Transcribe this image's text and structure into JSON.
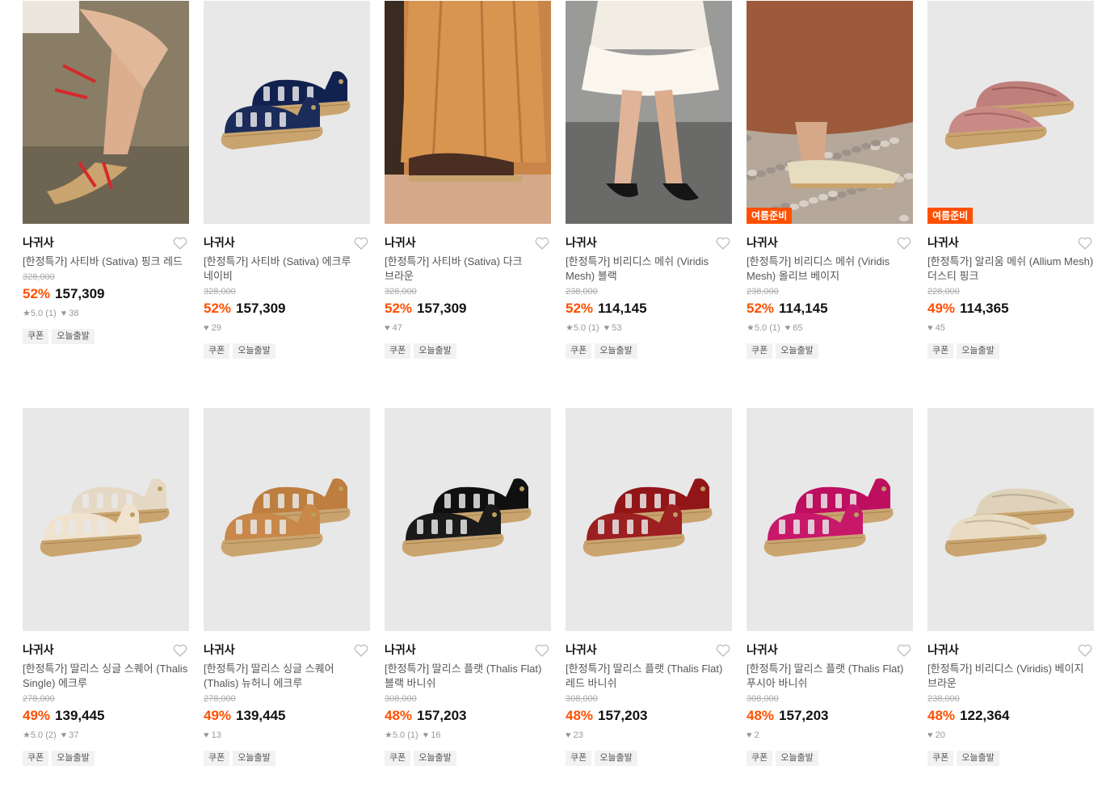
{
  "products": [
    {
      "brand": "나귀사",
      "name": "[한정특가] 사티바 (Sativa) 핑크 레드",
      "original_price": "328,000",
      "discount": "52%",
      "price": "157,309",
      "rating": "5.0 (1)",
      "likes": "38",
      "badge": "",
      "tags": [
        "쿠폰",
        "오늘출발"
      ],
      "image": {
        "bg": "#8a7d66",
        "kind": "photo-legs",
        "accent": "#d42a2a"
      }
    },
    {
      "brand": "나귀사",
      "name": "[한정특가] 사티바 (Sativa) 에크루 네이비",
      "original_price": "328,000",
      "discount": "52%",
      "price": "157,309",
      "rating": "",
      "likes": "29",
      "badge": "",
      "tags": [
        "쿠폰",
        "오늘출발"
      ],
      "image": {
        "bg": "#e8e8e8",
        "kind": "product",
        "accent": "#1c2c5a"
      }
    },
    {
      "brand": "나귀사",
      "name": "[한정특가] 사티바 (Sativa) 다크 브라운",
      "original_price": "328,000",
      "discount": "52%",
      "price": "157,309",
      "rating": "",
      "likes": "47",
      "badge": "",
      "tags": [
        "쿠폰",
        "오늘출발"
      ],
      "image": {
        "bg": "#c9844a",
        "kind": "photo-dress",
        "accent": "#4a2e22"
      }
    },
    {
      "brand": "나귀사",
      "name": "[한정특가] 비리디스 메쉬 (Viridis Mesh) 블랙",
      "original_price": "238,000",
      "discount": "52%",
      "price": "114,145",
      "rating": "5.0 (1)",
      "likes": "53",
      "badge": "",
      "tags": [
        "쿠폰",
        "오늘출발"
      ],
      "image": {
        "bg": "#9a9a98",
        "kind": "photo-skirt",
        "accent": "#151515"
      }
    },
    {
      "brand": "나귀사",
      "name": "[한정특가] 비리디스 메쉬 (Viridis Mesh) 올리브 베이지",
      "original_price": "238,000",
      "discount": "52%",
      "price": "114,145",
      "rating": "5.0 (1)",
      "likes": "65",
      "badge": "여름준비",
      "tags": [
        "쿠폰",
        "오늘출발"
      ],
      "image": {
        "bg": "#b5a89a",
        "kind": "photo-gravel",
        "accent": "#e6dcc0"
      }
    },
    {
      "brand": "나귀사",
      "name": "[한정특가] 알리움 메쉬 (Allium Mesh) 더스티 핑크",
      "original_price": "228,000",
      "discount": "49%",
      "price": "114,365",
      "rating": "",
      "likes": "45",
      "badge": "여름준비",
      "tags": [
        "쿠폰",
        "오늘출발"
      ],
      "image": {
        "bg": "#e8e8e8",
        "kind": "product-flat",
        "accent": "#c98a86"
      }
    },
    {
      "brand": "나귀사",
      "name": "[한정특가] 딸리스 싱글 스퀘어 (Thalis Single) 에크루",
      "original_price": "278,000",
      "discount": "49%",
      "price": "139,445",
      "rating": "5.0 (2)",
      "likes": "37",
      "badge": "",
      "tags": [
        "쿠폰",
        "오늘출발"
      ],
      "image": {
        "bg": "#e8e8e8",
        "kind": "product",
        "accent": "#efe3cf"
      }
    },
    {
      "brand": "나귀사",
      "name": "[한정특가] 딸리스 싱글 스퀘어 (Thalis) 뉴허니 에크루",
      "original_price": "278,000",
      "discount": "49%",
      "price": "139,445",
      "rating": "",
      "likes": "13",
      "badge": "",
      "tags": [
        "쿠폰",
        "오늘출발"
      ],
      "image": {
        "bg": "#e8e8e8",
        "kind": "product",
        "accent": "#c7884a"
      }
    },
    {
      "brand": "나귀사",
      "name": "[한정특가] 딸리스 플랫 (Thalis Flat) 블랙 바니쉬",
      "original_price": "308,000",
      "discount": "48%",
      "price": "157,203",
      "rating": "5.0 (1)",
      "likes": "16",
      "badge": "",
      "tags": [
        "쿠폰",
        "오늘출발"
      ],
      "image": {
        "bg": "#e8e8e8",
        "kind": "product",
        "accent": "#1a1a1a"
      }
    },
    {
      "brand": "나귀사",
      "name": "[한정특가] 딸리스 플랫 (Thalis Flat) 레드 바니쉬",
      "original_price": "308,000",
      "discount": "48%",
      "price": "157,203",
      "rating": "",
      "likes": "23",
      "badge": "",
      "tags": [
        "쿠폰",
        "오늘출발"
      ],
      "image": {
        "bg": "#e8e8e8",
        "kind": "product",
        "accent": "#9c1f22"
      }
    },
    {
      "brand": "나귀사",
      "name": "[한정특가] 딸리스 플랫 (Thalis Flat) 푸시아 바니쉬",
      "original_price": "308,000",
      "discount": "48%",
      "price": "157,203",
      "rating": "",
      "likes": "2",
      "badge": "",
      "tags": [
        "쿠폰",
        "오늘출발"
      ],
      "image": {
        "bg": "#e8e8e8",
        "kind": "product",
        "accent": "#c8186a"
      }
    },
    {
      "brand": "나귀사",
      "name": "[한정특가] 비리디스 (Viridis) 베이지 브라운",
      "original_price": "238,000",
      "discount": "48%",
      "price": "122,364",
      "rating": "",
      "likes": "20",
      "badge": "",
      "tags": [
        "쿠폰",
        "오늘출발"
      ],
      "image": {
        "bg": "#e8e8e8",
        "kind": "product-flat",
        "accent": "#e8dcc4"
      }
    }
  ],
  "colors": {
    "discount": "#ff4f00",
    "badge_bg": "#ff4f00",
    "tag_bg": "#f2f2f2",
    "strike": "#aaaaaa"
  },
  "icons": {
    "wishlist": "heart-outline-icon",
    "rating": "star-icon",
    "likes": "heart-icon"
  }
}
